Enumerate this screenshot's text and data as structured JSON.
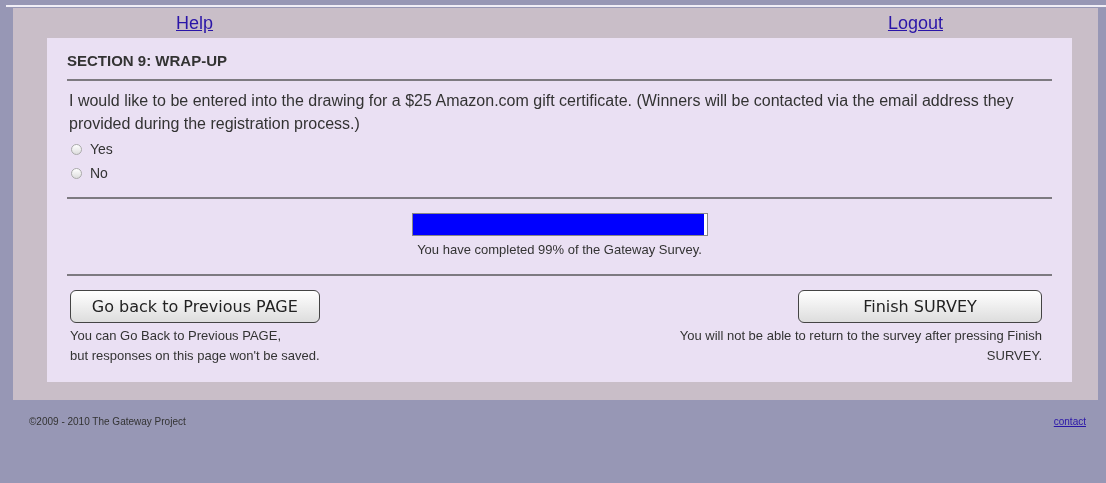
{
  "header_links": [
    {
      "label": "Help"
    },
    {
      "label": "Logout"
    }
  ],
  "section": {
    "title": "SECTION 9: WRAP-UP",
    "question": "I would like to be entered into the drawing for a $25 Amazon.com gift certificate. (Winners will be contacted via the email address they provided during the registration process.)",
    "options": [
      {
        "label": "Yes",
        "selected": false
      },
      {
        "label": "No",
        "selected": false
      }
    ]
  },
  "progress": {
    "level": 0.99,
    "caption": "You have completed 99% of the Gateway Survey."
  },
  "actions": [
    {
      "label": "Go back to Previous PAGE",
      "note_lines": [
        "You can Go Back to Previous PAGE,",
        "but responses on this page won't be saved."
      ]
    },
    {
      "label": "Finish SURVEY",
      "note_lines": [
        "You will not be able to return to the survey after pressing Finish",
        "SURVEY."
      ]
    }
  ],
  "footer": {
    "copyright": "©2009 - 2010 The Gateway Project",
    "link": "contact"
  }
}
